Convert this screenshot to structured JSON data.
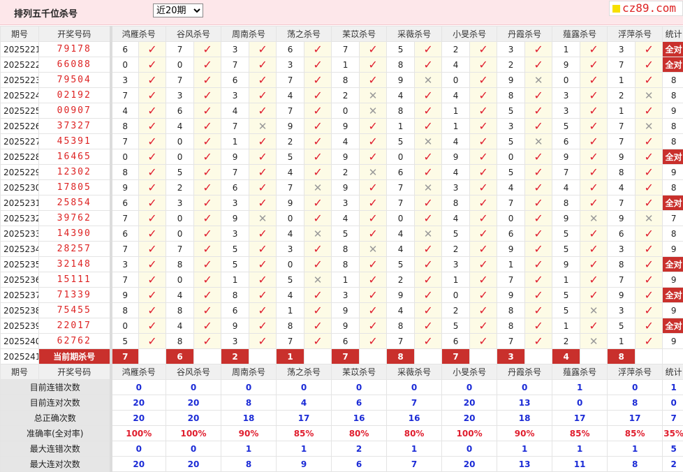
{
  "header": {
    "title": "排列五千位杀号",
    "range_selected": "近20期",
    "logo_text": "cz89.com"
  },
  "columns": {
    "issue": "期号",
    "number": "开奖号码",
    "experts": [
      "鸿雁杀号",
      "谷风杀号",
      "周南杀号",
      "荡之杀号",
      "苿苡杀号",
      "采薇杀号",
      "小旻杀号",
      "丹霞杀号",
      "薤露杀号",
      "浮萍杀号"
    ],
    "stat": "统计"
  },
  "rows": [
    {
      "issue": "2025221",
      "num": "79178",
      "kills": [
        6,
        7,
        3,
        6,
        7,
        5,
        2,
        3,
        1,
        3
      ],
      "ok": [
        1,
        1,
        1,
        1,
        1,
        1,
        1,
        1,
        1,
        1
      ],
      "stat": "全对"
    },
    {
      "issue": "2025222",
      "num": "66088",
      "kills": [
        0,
        0,
        7,
        3,
        1,
        8,
        4,
        2,
        9,
        7
      ],
      "ok": [
        1,
        1,
        1,
        1,
        1,
        1,
        1,
        1,
        1,
        1
      ],
      "stat": "全对"
    },
    {
      "issue": "2025223",
      "num": "79504",
      "kills": [
        3,
        7,
        6,
        7,
        8,
        9,
        0,
        9,
        0,
        1
      ],
      "ok": [
        1,
        1,
        1,
        1,
        1,
        0,
        1,
        0,
        1,
        1
      ],
      "stat": "8"
    },
    {
      "issue": "2025224",
      "num": "02192",
      "kills": [
        7,
        3,
        3,
        4,
        2,
        4,
        4,
        8,
        3,
        2
      ],
      "ok": [
        1,
        1,
        1,
        1,
        0,
        1,
        1,
        1,
        1,
        0
      ],
      "stat": "8"
    },
    {
      "issue": "2025225",
      "num": "00907",
      "kills": [
        4,
        6,
        4,
        7,
        0,
        8,
        1,
        5,
        3,
        1
      ],
      "ok": [
        1,
        1,
        1,
        1,
        0,
        1,
        1,
        1,
        1,
        1
      ],
      "stat": "9"
    },
    {
      "issue": "2025226",
      "num": "37327",
      "kills": [
        8,
        4,
        7,
        9,
        9,
        1,
        1,
        3,
        5,
        7
      ],
      "ok": [
        1,
        1,
        0,
        1,
        1,
        1,
        1,
        1,
        1,
        0
      ],
      "stat": "8"
    },
    {
      "issue": "2025227",
      "num": "45391",
      "kills": [
        7,
        0,
        1,
        2,
        4,
        5,
        4,
        5,
        6,
        7
      ],
      "ok": [
        1,
        1,
        1,
        1,
        1,
        0,
        1,
        0,
        1,
        1
      ],
      "stat": "8"
    },
    {
      "issue": "2025228",
      "num": "16465",
      "kills": [
        0,
        0,
        9,
        5,
        9,
        0,
        9,
        0,
        9,
        9
      ],
      "ok": [
        1,
        1,
        1,
        1,
        1,
        1,
        1,
        1,
        1,
        1
      ],
      "stat": "全对"
    },
    {
      "issue": "2025229",
      "num": "12302",
      "kills": [
        8,
        5,
        7,
        4,
        2,
        6,
        4,
        5,
        7,
        8
      ],
      "ok": [
        1,
        1,
        1,
        1,
        0,
        1,
        1,
        1,
        1,
        1
      ],
      "stat": "9"
    },
    {
      "issue": "2025230",
      "num": "17805",
      "kills": [
        9,
        2,
        6,
        7,
        9,
        7,
        3,
        4,
        4,
        4
      ],
      "ok": [
        1,
        1,
        1,
        0,
        1,
        0,
        1,
        1,
        1,
        1
      ],
      "stat": "8"
    },
    {
      "issue": "2025231",
      "num": "25854",
      "kills": [
        6,
        3,
        3,
        9,
        3,
        7,
        8,
        7,
        8,
        7
      ],
      "ok": [
        1,
        1,
        1,
        1,
        1,
        1,
        1,
        1,
        1,
        1
      ],
      "stat": "全对"
    },
    {
      "issue": "2025232",
      "num": "39762",
      "kills": [
        7,
        0,
        9,
        0,
        4,
        0,
        4,
        0,
        9,
        9
      ],
      "ok": [
        1,
        1,
        0,
        1,
        1,
        1,
        1,
        1,
        0,
        0
      ],
      "stat": "7"
    },
    {
      "issue": "2025233",
      "num": "14390",
      "kills": [
        6,
        0,
        3,
        4,
        5,
        4,
        5,
        6,
        5,
        6
      ],
      "ok": [
        1,
        1,
        1,
        0,
        1,
        0,
        1,
        1,
        1,
        1
      ],
      "stat": "8"
    },
    {
      "issue": "2025234",
      "num": "28257",
      "kills": [
        7,
        7,
        5,
        3,
        8,
        4,
        2,
        9,
        5,
        3
      ],
      "ok": [
        1,
        1,
        1,
        1,
        0,
        1,
        1,
        1,
        1,
        1
      ],
      "stat": "9"
    },
    {
      "issue": "2025235",
      "num": "32148",
      "kills": [
        3,
        8,
        5,
        0,
        8,
        5,
        3,
        1,
        9,
        8
      ],
      "ok": [
        1,
        1,
        1,
        1,
        1,
        1,
        1,
        1,
        1,
        1
      ],
      "stat": "全对"
    },
    {
      "issue": "2025236",
      "num": "15111",
      "kills": [
        7,
        0,
        1,
        5,
        1,
        2,
        1,
        7,
        1,
        7
      ],
      "ok": [
        1,
        1,
        1,
        0,
        1,
        1,
        1,
        1,
        1,
        1
      ],
      "stat": "9"
    },
    {
      "issue": "2025237",
      "num": "71339",
      "kills": [
        9,
        4,
        8,
        4,
        3,
        9,
        0,
        9,
        5,
        9
      ],
      "ok": [
        1,
        1,
        1,
        1,
        1,
        1,
        1,
        1,
        1,
        1
      ],
      "stat": "全对"
    },
    {
      "issue": "2025238",
      "num": "75455",
      "kills": [
        8,
        8,
        6,
        1,
        9,
        4,
        2,
        8,
        5,
        3
      ],
      "ok": [
        1,
        1,
        1,
        1,
        1,
        1,
        1,
        1,
        0,
        1
      ],
      "stat": "9"
    },
    {
      "issue": "2025239",
      "num": "22017",
      "kills": [
        0,
        4,
        9,
        8,
        9,
        8,
        5,
        8,
        1,
        5
      ],
      "ok": [
        1,
        1,
        1,
        1,
        1,
        1,
        1,
        1,
        1,
        1
      ],
      "stat": "全对"
    },
    {
      "issue": "2025240",
      "num": "62762",
      "kills": [
        5,
        8,
        3,
        7,
        6,
        7,
        6,
        7,
        2,
        1
      ],
      "ok": [
        1,
        1,
        1,
        1,
        1,
        1,
        1,
        1,
        0,
        1
      ],
      "stat": "9"
    }
  ],
  "current": {
    "issue": "2025241",
    "label": "当前期杀号",
    "kills": [
      "7",
      "6",
      "2",
      "1",
      "7",
      "8",
      "7",
      "3",
      "4",
      "8"
    ]
  },
  "summary": {
    "rows": [
      {
        "label": "目前连错次数",
        "vals": [
          "0",
          "0",
          "0",
          "0",
          "0",
          "0",
          "0",
          "0",
          "1",
          "0"
        ],
        "stat": "1",
        "red": false
      },
      {
        "label": "目前连对次数",
        "vals": [
          "20",
          "20",
          "8",
          "4",
          "6",
          "7",
          "20",
          "13",
          "0",
          "8"
        ],
        "stat": "0",
        "red": false
      },
      {
        "label": "总正确次数",
        "vals": [
          "20",
          "20",
          "18",
          "17",
          "16",
          "16",
          "20",
          "18",
          "17",
          "17"
        ],
        "stat": "7",
        "red": false
      },
      {
        "label": "准确率(全对率)",
        "vals": [
          "100%",
          "100%",
          "90%",
          "85%",
          "80%",
          "80%",
          "100%",
          "90%",
          "85%",
          "85%"
        ],
        "stat": "35%",
        "red": true
      },
      {
        "label": "最大连错次数",
        "vals": [
          "0",
          "0",
          "1",
          "1",
          "2",
          "1",
          "0",
          "1",
          "1",
          "1"
        ],
        "stat": "5",
        "red": false
      },
      {
        "label": "最大连对次数",
        "vals": [
          "20",
          "20",
          "8",
          "9",
          "6",
          "7",
          "20",
          "13",
          "11",
          "8"
        ],
        "stat": "2",
        "red": false
      }
    ]
  },
  "marks": {
    "ok": "✓",
    "bad": "✕"
  },
  "colors": {
    "accent_red": "#c9302c",
    "mark_red": "#e01e2e",
    "stat_blue": "#1b2bd6",
    "mark_bg": "#fdfbe6"
  }
}
